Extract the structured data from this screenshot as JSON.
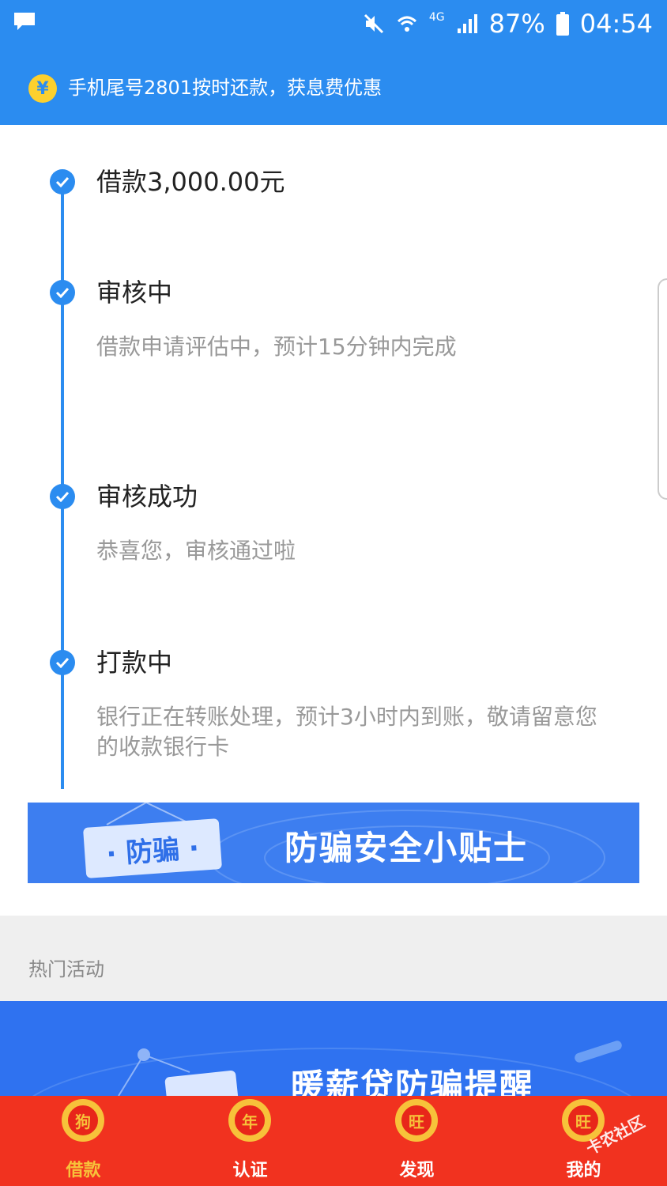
{
  "status_bar": {
    "network": "4G",
    "battery": "87%",
    "time": "04:54"
  },
  "notice": {
    "icon": "yen-icon",
    "currency_symbol": "¥",
    "text": "手机尾号2801按时还款，获息费优惠"
  },
  "timeline": {
    "steps": [
      {
        "title": "借款3,000.00元",
        "desc": ""
      },
      {
        "title": "审核中",
        "desc": "借款申请评估中，预计15分钟内完成"
      },
      {
        "title": "审核成功",
        "desc": "恭喜您，审核通过啦"
      },
      {
        "title": "打款中",
        "desc": "银行正在转账处理，预计3小时内到账，敬请留意您的收款银行卡"
      }
    ]
  },
  "tip_banner": {
    "tag": "· 防骗 ·",
    "headline": "防骗安全小贴士"
  },
  "hot_section": {
    "label": "热门活动"
  },
  "promo_banner": {
    "headline": "暖薪贷防骗提醒"
  },
  "tabbar": {
    "tabs": [
      {
        "label": "借款",
        "badge": "狗",
        "active": true
      },
      {
        "label": "认证",
        "badge": "年",
        "active": false
      },
      {
        "label": "发现",
        "badge": "旺",
        "active": false
      },
      {
        "label": "我的",
        "badge": "旺",
        "active": false
      }
    ]
  },
  "watermark": "卡农社区",
  "colors": {
    "primary_blue": "#2b8cf0",
    "tab_red": "#f1321f",
    "gold": "#f7c23a"
  }
}
